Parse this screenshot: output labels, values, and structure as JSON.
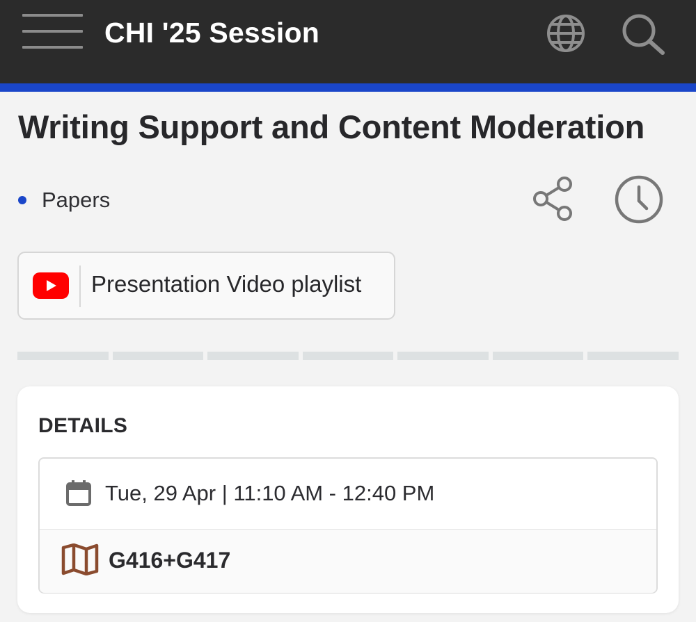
{
  "app_bar": {
    "title": "CHI '25 Session",
    "icons": {
      "menu": "hamburger-menu-icon",
      "language": "globe-icon",
      "search": "search-icon"
    }
  },
  "session": {
    "title": "Writing Support and Content Moderation",
    "type": "Papers",
    "actions": {
      "share": "share-icon",
      "schedule": "clock-icon"
    }
  },
  "video_link": {
    "label": "Presentation Video playlist",
    "icon": "youtube-icon"
  },
  "progress": {
    "segments": 7
  },
  "details": {
    "heading": "DETAILS",
    "datetime": "Tue, 29 Apr | 11:10 AM - 12:40 PM",
    "room": "G416+G417"
  },
  "colors": {
    "app_bar_bg": "#2b2b2b",
    "accent_blue": "#1a46c9",
    "page_bg": "#f3f3f3",
    "youtube_red": "#ff0000",
    "map_brown": "#8a4b2e",
    "icon_gray": "#777777"
  }
}
